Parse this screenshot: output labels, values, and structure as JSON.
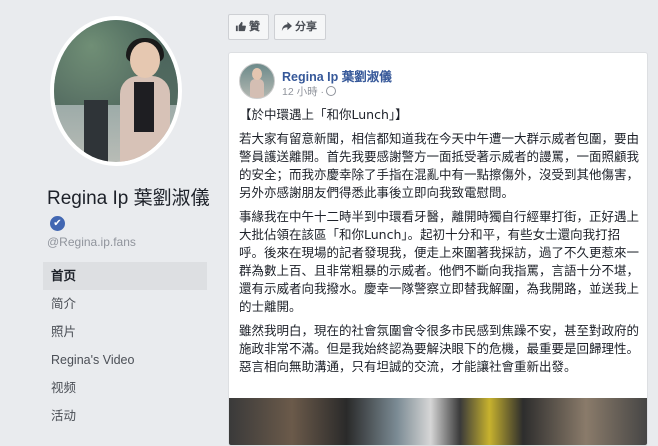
{
  "profile": {
    "name": "Regina Ip 葉劉淑儀",
    "handle": "@Regina.ip.fans",
    "verified_icon": "✔"
  },
  "nav": {
    "items": [
      {
        "label": "首页"
      },
      {
        "label": "简介"
      },
      {
        "label": "照片"
      },
      {
        "label": "Regina's Video"
      },
      {
        "label": "视频"
      },
      {
        "label": "活动"
      }
    ]
  },
  "actions": {
    "like_label": "贊",
    "share_label": "分享"
  },
  "post": {
    "author": "Regina Ip 葉劉淑儀",
    "time": "12 小時 ·",
    "title": "【於中環遇上「和你Lunch」】",
    "paragraphs": [
      "若大家有留意新聞，相信都知道我在今天中午遭一大群示威者包圍，要由警員護送離開。首先我要感謝警方一面抵受著示威者的謾罵，一面照顧我的安全；而我亦慶幸除了手指在混亂中有一點擦傷外，沒受到其他傷害，另外亦感謝朋友們得悉此事後立即向我致電慰問。",
      "事緣我在中午十二時半到中環看牙醫，離開時獨自行經畢打街，正好遇上大批佔領在該區「和你Lunch」。起初十分和平，有些女士還向我打招呼。後來在現場的記者發現我，便走上來圍著我採訪，過了不久更惹來一群為數上百、且非常粗暴的示威者。他們不斷向我指罵，言語十分不堪，還有示威者向我撥水。慶幸一隊警察立即替我解圍，為我開路，並送我上的士離開。",
      "雖然我明白，現在的社會氛圍會令很多市民感到焦躁不安，甚至對政府的施政非常不滿。但是我始終認為要解決眼下的危機，最重要是回歸理性。惡言相向無助溝通，只有坦誠的交流，才能讓社會重新出發。"
    ]
  }
}
